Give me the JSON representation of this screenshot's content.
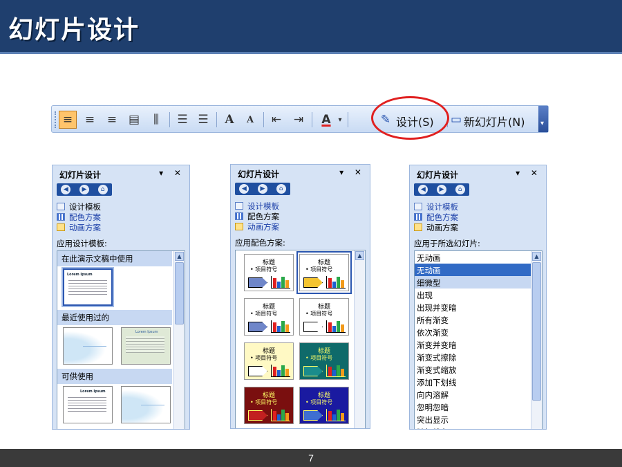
{
  "slide": {
    "title": "幻灯片设计",
    "page_number": "7"
  },
  "toolbar": {
    "design_label": "设计(S)",
    "new_slide_label": "新幻灯片(N)",
    "icons": [
      "align-left-icon",
      "align-center-icon",
      "align-right-icon",
      "distribute-icon",
      "text-direction-icon",
      "numbering-icon",
      "bullets-icon",
      "increase-font-icon",
      "decrease-font-icon",
      "decrease-indent-icon",
      "increase-indent-icon",
      "font-color-icon"
    ],
    "increase_font_glyph": "A",
    "decrease_font_glyph": "A",
    "font_color_glyph": "A",
    "highlight_color": "#e02020"
  },
  "panes": {
    "common": {
      "title": "幻灯片设计",
      "links": [
        "设计模板",
        "配色方案",
        "动画方案"
      ]
    },
    "design_templates": {
      "apply_label": "应用设计模板:",
      "groups": [
        "在此演示文稿中使用",
        "最近使用过的",
        "可供使用"
      ],
      "thumb_titles": [
        "Lorem Ipsum",
        "Lorem Ipsum",
        "Lorem Ipsum"
      ]
    },
    "color_schemes": {
      "apply_label": "应用配色方案:",
      "sample_title": "标题",
      "sample_bullet": "• 项目符号",
      "schemes": [
        {
          "bg": "#ffffff",
          "fg": "#000000",
          "accent": "#6f86c9"
        },
        {
          "bg": "#ffffff",
          "fg": "#000000",
          "accent": "#f4c430"
        },
        {
          "bg": "#ffffff",
          "fg": "#000000",
          "accent": "#6f86c9"
        },
        {
          "bg": "#ffffff",
          "fg": "#000000",
          "accent": "#ffffff"
        },
        {
          "bg": "#fff9c4",
          "fg": "#000000",
          "accent": "#ffffff"
        },
        {
          "bg": "#0f6a6a",
          "fg": "#ffff66",
          "accent": "#1a8c8c"
        },
        {
          "bg": "#7a0f0f",
          "fg": "#ffff66",
          "accent": "#c22020"
        },
        {
          "bg": "#1a1aa0",
          "fg": "#ffff66",
          "accent": "#3f6fd1"
        }
      ]
    },
    "animation": {
      "apply_label": "应用于所选幻灯片:",
      "items": [
        "无动画",
        "无动画",
        "细微型",
        "出现",
        "出现并变暗",
        "所有渐变",
        "依次渐变",
        "渐变并变暗",
        "渐变式擦除",
        "渐变式缩放",
        "添加下划线",
        "向内溶解",
        "忽明忽暗",
        "突出显示",
        "随机线条"
      ],
      "selected_index": 1
    }
  }
}
